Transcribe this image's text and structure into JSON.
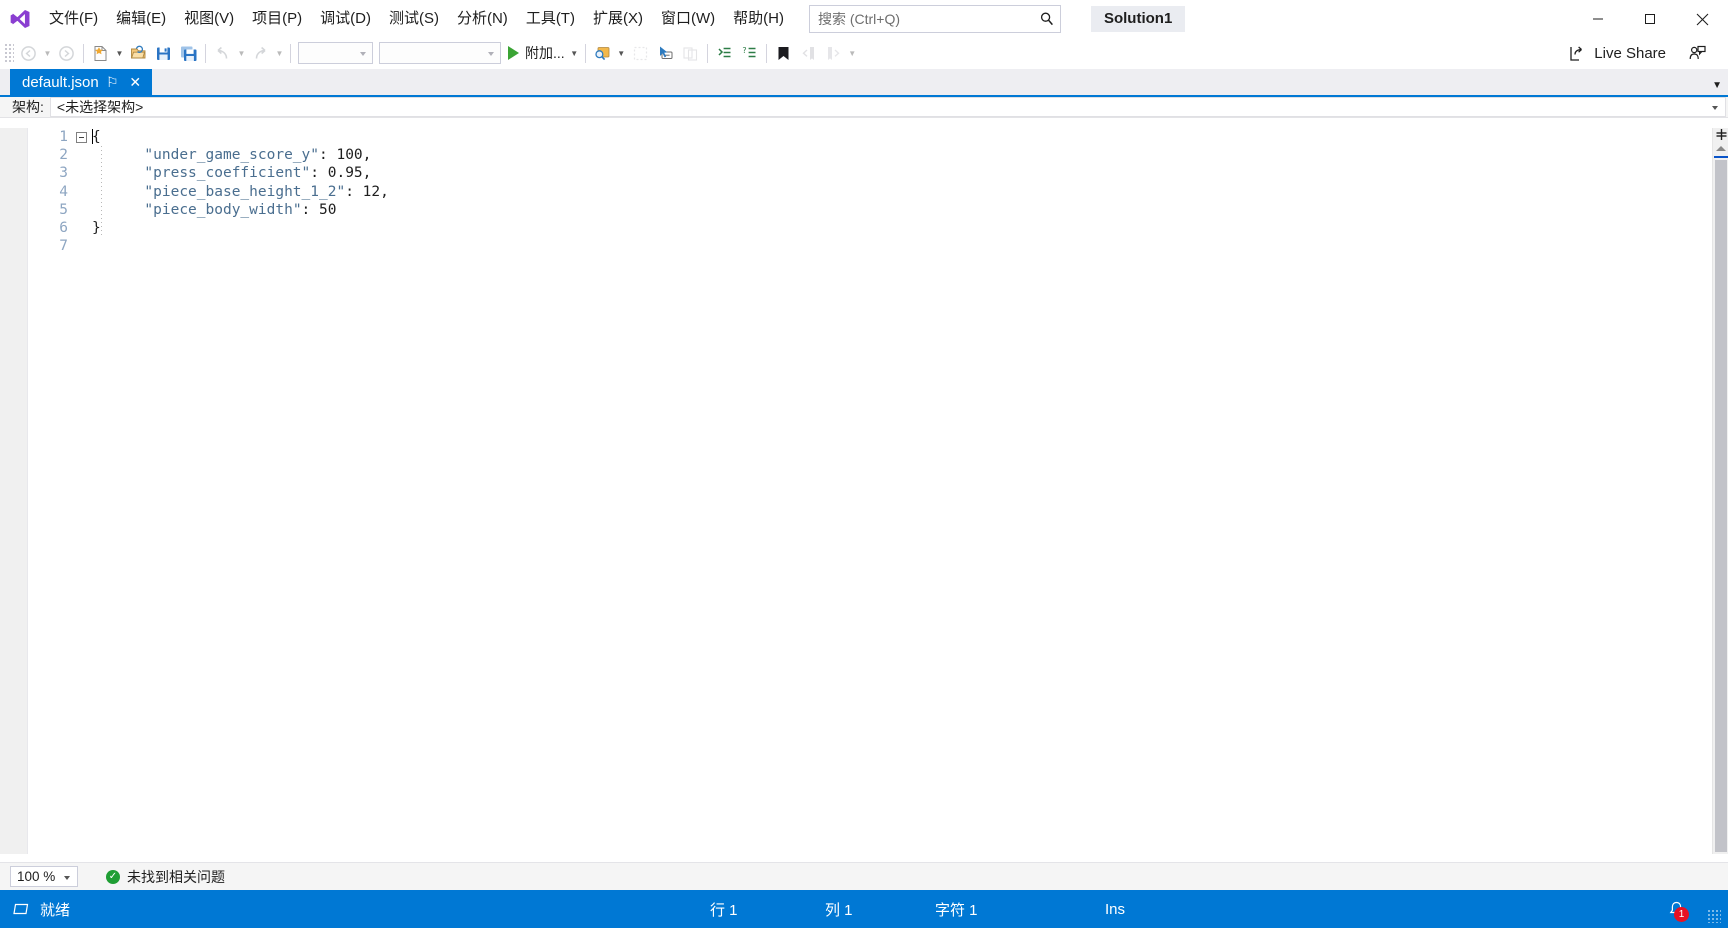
{
  "window": {
    "solution_name": "Solution1",
    "minimize_label": "–",
    "maximize_label": "☐",
    "close_label": "✕"
  },
  "menubar": {
    "items": [
      {
        "label": "文件(F)",
        "name": "menu-file"
      },
      {
        "label": "编辑(E)",
        "name": "menu-edit"
      },
      {
        "label": "视图(V)",
        "name": "menu-view"
      },
      {
        "label": "项目(P)",
        "name": "menu-project"
      },
      {
        "label": "调试(D)",
        "name": "menu-debug"
      },
      {
        "label": "测试(S)",
        "name": "menu-test"
      },
      {
        "label": "分析(N)",
        "name": "menu-analyze"
      },
      {
        "label": "工具(T)",
        "name": "menu-tools"
      },
      {
        "label": "扩展(X)",
        "name": "menu-extensions"
      },
      {
        "label": "窗口(W)",
        "name": "menu-window"
      },
      {
        "label": "帮助(H)",
        "name": "menu-help"
      }
    ]
  },
  "search": {
    "placeholder": "搜索 (Ctrl+Q)",
    "value": ""
  },
  "toolbar": {
    "attach_label": "附加...",
    "config_value": "",
    "platform_value": "",
    "live_share_label": "Live Share"
  },
  "tabs": [
    {
      "label": "default.json",
      "pin_glyph": "⚐",
      "close_glyph": "✕",
      "active": true
    }
  ],
  "schema": {
    "label": "架构:",
    "value": "<未选择架构>"
  },
  "editor": {
    "lines": [
      {
        "number": "1",
        "indent": 0,
        "text": "{",
        "type": "brace"
      },
      {
        "number": "2",
        "indent": 2,
        "key": "under_game_score_y",
        "value": "100",
        "comma": ","
      },
      {
        "number": "3",
        "indent": 2,
        "key": "press_coefficient",
        "value": "0.95",
        "comma": ","
      },
      {
        "number": "4",
        "indent": 2,
        "key": "piece_base_height_1_2",
        "value": "12",
        "comma": ","
      },
      {
        "number": "5",
        "indent": 2,
        "key": "piece_body_width",
        "value": "50",
        "comma": ""
      },
      {
        "number": "6",
        "indent": 0,
        "text": "}",
        "type": "brace"
      },
      {
        "number": "7",
        "indent": 0,
        "text": "",
        "type": "empty"
      }
    ],
    "raw_json": {
      "under_game_score_y": 100,
      "press_coefficient": 0.95,
      "piece_base_height_1_2": 12,
      "piece_body_width": 50
    }
  },
  "zoomrow": {
    "zoom_level": "100 %",
    "issue_text": "未找到相关问题",
    "issue_ok_glyph": "✓"
  },
  "statusbar": {
    "ready_text": "就绪",
    "line_label": "行 1",
    "column_label": "列 1",
    "char_label": "字符 1",
    "insert_mode": "Ins",
    "notification_count": "1"
  },
  "colors": {
    "accent_blue": "#0078d4",
    "json_key": "#4a6e8f",
    "line_number": "#8ea6c2",
    "badge_red": "#e81123",
    "ok_green": "#1f9e34",
    "toolbar_bg": "#ffffff",
    "schema_bg": "#f5f5f5"
  }
}
